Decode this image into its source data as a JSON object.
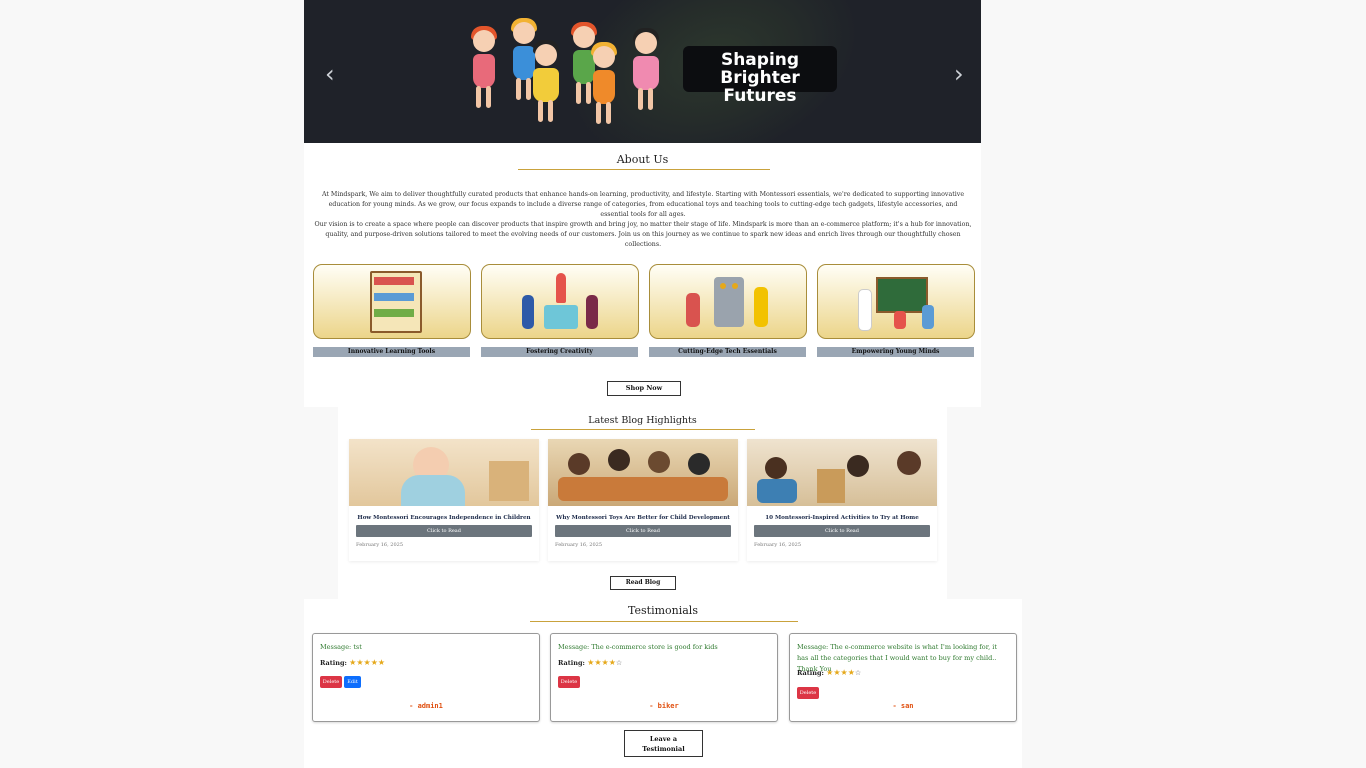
{
  "hero": {
    "title_line1": "Shaping",
    "title_line2": "Brighter Futures",
    "prev_icon": "chevron-left-icon",
    "next_icon": "chevron-right-icon",
    "prev_glyph": "‹",
    "next_glyph": "›"
  },
  "about": {
    "title": "About Us",
    "paragraph1": "At Mindspark, We aim to deliver thoughtfully curated products that enhance hands-on learning, productivity, and lifestyle. Starting with Montessori essentials, we're dedicated to supporting innovative education for young minds. As we grow, our focus expands to include a diverse range of categories, from educational toys and teaching tools to cutting-edge tech gadgets, lifestyle accessories, and essential tools for all ages.",
    "paragraph2": "Our vision is to create a space where people can discover products that inspire growth and bring joy, no matter their stage of life. Mindspark is more than an e-commerce platform; it's a hub for innovation, quality, and purpose-driven solutions tailored to meet the evolving needs of our customers. Join us on this journey as we continue to spark new ideas and enrich lives through our thoughtfully chosen collections.",
    "features": [
      {
        "label": "Innovative Learning Tools"
      },
      {
        "label": "Fostering Creativity"
      },
      {
        "label": "Cutting-Edge Tech Essentials"
      },
      {
        "label": "Empowering Young Minds"
      }
    ],
    "shop_button": "Shop Now"
  },
  "blog": {
    "title": "Latest Blog Highlights",
    "posts": [
      {
        "title": "How Montessori Encourages Independence in Children",
        "button": "Click to Read",
        "date": "February 16, 2025"
      },
      {
        "title": "Why Montessori Toys Are Better for Child Development",
        "button": "Click to Read",
        "date": "February 16, 2025"
      },
      {
        "title": "10 Montessori-Inspired Activities to Try at Home",
        "button": "Click to Read",
        "date": "February 16, 2025"
      }
    ],
    "read_button": "Read Blog"
  },
  "testimonials": {
    "title": "Testimonials",
    "items": [
      {
        "message": "Message: tst",
        "rating_label": "Rating:",
        "rating": 5,
        "delete": "Delete",
        "edit": "Edit",
        "user": "- admin1"
      },
      {
        "message": "Message: The e-commerce store is good for kids",
        "rating_label": "Rating:",
        "rating": 4,
        "delete": "Delete",
        "user": "- biker"
      },
      {
        "message": "Message: The e-commerce website is what I'm looking for, it has all the categories that I would want to buy for my child.. Thank You",
        "rating_label": "Rating:",
        "rating": 4,
        "delete": "Delete",
        "user": "- san"
      }
    ],
    "leave_button_line1": "Leave a",
    "leave_button_line2": "Testimonial"
  },
  "colors": {
    "hero_bg": "#1f2229",
    "gold_accent": "#c9a23c",
    "delete_red": "#dc3545",
    "edit_blue": "#0d6efd",
    "message_green": "#2f7a2f",
    "user_orange": "#e05010"
  }
}
